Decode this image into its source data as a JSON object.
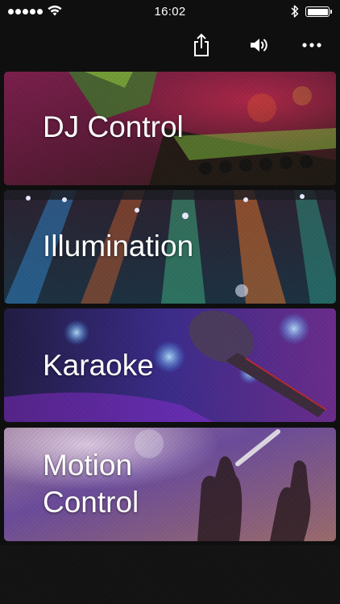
{
  "status_bar": {
    "time": "16:02",
    "signal_icon": "cellular-signal-icon",
    "wifi_icon": "wifi-icon",
    "bluetooth_icon": "bluetooth-icon",
    "battery_icon": "battery-icon",
    "battery_level": 1.0
  },
  "toolbar": {
    "share_icon": "share-icon",
    "sound_icon": "speaker-icon",
    "more_icon": "more-icon"
  },
  "modes": [
    {
      "label": "DJ Control"
    },
    {
      "label": "Illumination"
    },
    {
      "label": "Karaoke"
    },
    {
      "label": "Motion\nControl"
    }
  ],
  "colors": {
    "background": "#0f0f0f",
    "text": "#ffffff"
  }
}
